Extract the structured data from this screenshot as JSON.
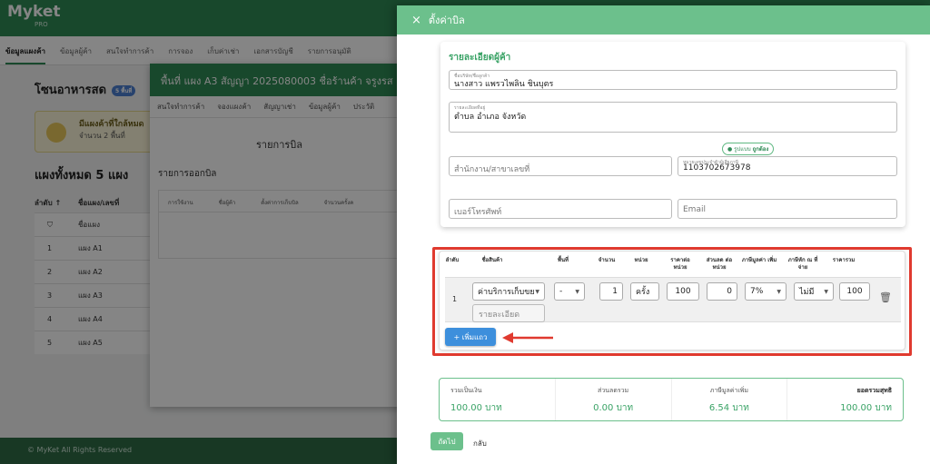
{
  "app": {
    "logo": "Myket",
    "logo_sub": "PRO"
  },
  "bg_nav": {
    "items": [
      "ข้อมูลแผงค้า",
      "ข้อมูลผู้ค้า",
      "สนใจทำการค้า",
      "การจอง",
      "เก็บค่าเช่า",
      "เอกสารบัญชี",
      "รายการอนุมัติ"
    ]
  },
  "bg_zone": {
    "title": "โซนอาหารสด",
    "badge": "5 พื้นที่"
  },
  "bg_alert": {
    "title": "มีแผงค้าที่ใกล้หมด",
    "count": "จำนวน 2 พื้นที่"
  },
  "bg_zones": {
    "title": "แผงทั้งหมด 5 แผง",
    "headers": [
      "ลำดับ ↑",
      "ชื่อแผง/เลขที่"
    ],
    "filter": "ชื่อแผง",
    "rows": [
      {
        "no": "1",
        "name": "แผง A1"
      },
      {
        "no": "2",
        "name": "แผง A2"
      },
      {
        "no": "3",
        "name": "แผง A3"
      },
      {
        "no": "4",
        "name": "แผง A4"
      },
      {
        "no": "5",
        "name": "แผง A5"
      }
    ]
  },
  "bg_footer": "© MyKet All Rights Reserved",
  "mid_modal": {
    "title": "พื้นที่ แผง A3 สัญญา 2025080003 ชื่อร้านค้า จรูงรส",
    "tabs": [
      "สนใจทำการค้า",
      "จองแผงค้า",
      "สัญญาเช่า",
      "ข้อมูลผู้ค้า",
      "ประวัติ"
    ],
    "section_title": "รายการบิล",
    "sub_title": "รายการออกบิล",
    "table_headers": [
      "การใช้งาน",
      "ชื่อผู้ค้า",
      "ตั้งค่าการเก็บบิล",
      "จำนวนครั้งค"
    ]
  },
  "drawer": {
    "title": "ตั้งค่าบิล",
    "close_icon": "×",
    "customer": {
      "section_title": "รายละเอียดผู้ค้า",
      "name_label": "ชื่อบริษัท/ชื่อลูกค้า",
      "name_value": "นางสาว แพรวไพลิน ชินบุตร",
      "address_label": "รายละเอียดที่อยู่",
      "address_value": "ตำบล อำเภอ จังหวัด",
      "branch_placeholder": "สำนักงาน/สาขาเลขที่",
      "verify_prefix": "รูปแบบ",
      "verify_status": "ถูกต้อง",
      "taxid_label": "หมายเลขประจำตัวผู้เสียภาษี",
      "taxid_value": "1103702673978",
      "phone_placeholder": "เบอร์โทรศัพท์",
      "email_placeholder": "Email"
    },
    "items": {
      "headers": {
        "no": "ลำดับ",
        "product": "ชื่อสินค้า",
        "area": "พื้นที่",
        "qty": "จำนวน",
        "unit": "หน่วย",
        "unit_price": "ราคาต่อ หน่วย",
        "discount": "ส่วนลด ต่อหน่วย",
        "vat": "ภาษีมูลค่า เพิ่ม",
        "wht": "ภาษีหัก ณ ที่จ่าย",
        "total": "ราคารวม"
      },
      "row": {
        "no": "1",
        "product": "ค่าบริการเก็บขย",
        "detail_placeholder": "รายละเอียด",
        "area": "-",
        "qty": "1",
        "unit": "ครั้ง",
        "unit_price": "100",
        "discount": "0",
        "vat": "7%",
        "wht": "ไม่มี",
        "total": "100"
      },
      "add_button": "+ เพิ่มแถว"
    },
    "totals": {
      "subtotal_label": "รวมเป็นเงิน",
      "subtotal_value": "100.00 บาท",
      "discount_label": "ส่วนลดรวม",
      "discount_value": "0.00 บาท",
      "vat_label": "ภาษีมูลค่าเพิ่ม",
      "vat_value": "6.54 บาท",
      "net_label": "ยอดรวมสุทธิ",
      "net_value": "100.00 บาท"
    },
    "next_button": "ถัดไป",
    "back_button": "กลับ"
  },
  "colors": {
    "brand": "#2f8a55",
    "drawer_header": "#6cc08c",
    "highlight": "#e03a2f",
    "primary_button": "#3d8fdc"
  }
}
